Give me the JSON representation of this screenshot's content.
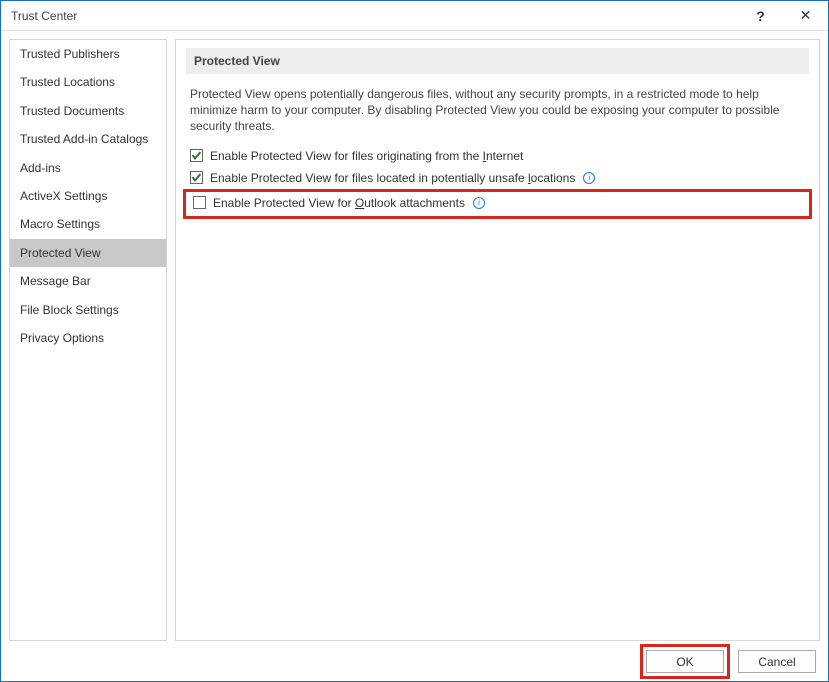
{
  "window": {
    "title": "Trust Center"
  },
  "sidebar": {
    "items": [
      {
        "label": "Trusted Publishers"
      },
      {
        "label": "Trusted Locations"
      },
      {
        "label": "Trusted Documents"
      },
      {
        "label": "Trusted Add-in Catalogs"
      },
      {
        "label": "Add-ins"
      },
      {
        "label": "ActiveX Settings"
      },
      {
        "label": "Macro Settings"
      },
      {
        "label": "Protected View",
        "selected": true
      },
      {
        "label": "Message Bar"
      },
      {
        "label": "File Block Settings"
      },
      {
        "label": "Privacy Options"
      }
    ]
  },
  "section": {
    "heading": "Protected View",
    "description": "Protected View opens potentially dangerous files, without any security prompts, in a restricted mode to help minimize harm to your computer. By disabling Protected View you could be exposing your computer to possible security threats.",
    "options": [
      {
        "checked": true,
        "pre": "Enable Protected View for files originating from the ",
        "accel": "I",
        "post": "nternet",
        "info": false,
        "highlighted": false
      },
      {
        "checked": true,
        "pre": "Enable Protected View for files located in potentially unsafe ",
        "accel": "l",
        "post": "ocations",
        "info": true,
        "highlighted": false
      },
      {
        "checked": false,
        "pre": "Enable Protected View for ",
        "accel": "O",
        "post": "utlook attachments",
        "info": true,
        "highlighted": true
      }
    ]
  },
  "buttons": {
    "ok": "OK",
    "cancel": "Cancel"
  },
  "icons": {
    "help": "?",
    "close": "✕",
    "info": "i"
  }
}
